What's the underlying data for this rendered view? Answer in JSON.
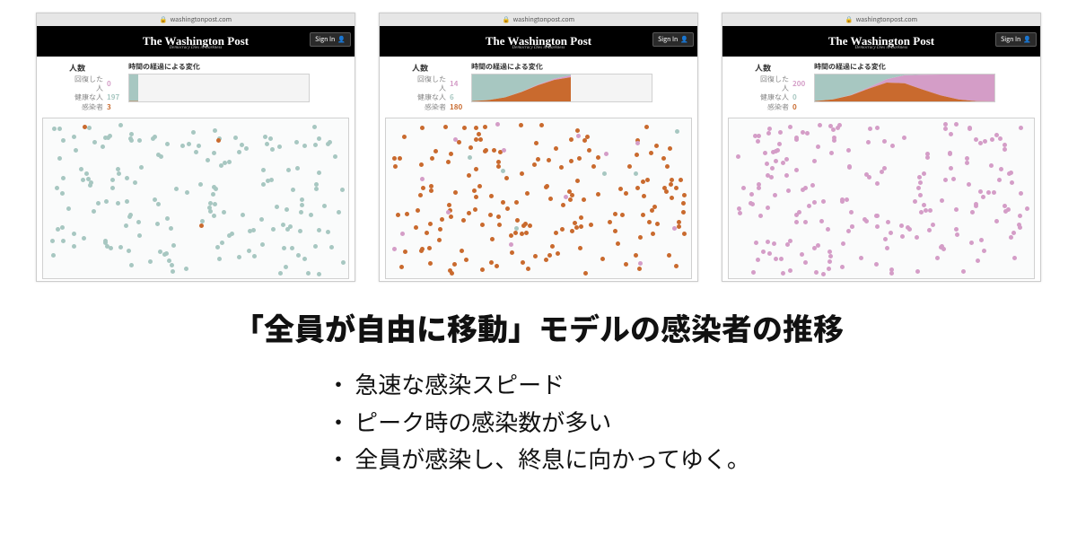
{
  "url_bar": {
    "domain": "washingtonpost.com"
  },
  "header": {
    "logo": "The Washington Post",
    "tagline": "Democracy Dies in Darkness",
    "sign_in": "Sign In"
  },
  "legend": {
    "count_title": "人数",
    "chart_title": "時間の経過による変化",
    "recovered_label": "回復した人",
    "healthy_label": "健康な人",
    "infected_label": "感染者"
  },
  "colors": {
    "healthy": "#a7c7c1",
    "infected": "#c96a2e",
    "recovered": "#d49dc7"
  },
  "panels": [
    {
      "recovered": 0,
      "healthy": 197,
      "infected": 3,
      "progress": 0.05,
      "dots": {
        "healthy": 170,
        "infected": 3,
        "recovered": 0
      }
    },
    {
      "recovered": 14,
      "healthy": 6,
      "infected": 180,
      "progress": 0.55,
      "dots": {
        "healthy": 6,
        "infected": 175,
        "recovered": 14
      }
    },
    {
      "recovered": 200,
      "healthy": 0,
      "infected": 0,
      "progress": 1.0,
      "dots": {
        "healthy": 0,
        "infected": 0,
        "recovered": 200
      }
    }
  ],
  "chart_data": [
    {
      "type": "area",
      "title": "時間の経過による変化",
      "xlabel": "",
      "ylabel": "",
      "x_progress": 0.05,
      "total": 200,
      "series": [
        {
          "name": "回復した人",
          "color": "#d49dc7",
          "values": [
            0,
            0
          ]
        },
        {
          "name": "感染者",
          "color": "#c96a2e",
          "values": [
            3,
            3
          ]
        },
        {
          "name": "健康な人",
          "color": "#a7c7c1",
          "values": [
            197,
            197
          ]
        }
      ]
    },
    {
      "type": "area",
      "title": "時間の経過による変化",
      "xlabel": "",
      "ylabel": "",
      "x_progress": 0.55,
      "total": 200,
      "series": [
        {
          "name": "回復した人",
          "color": "#d49dc7",
          "values": [
            0,
            0,
            0,
            2,
            5,
            9,
            14
          ]
        },
        {
          "name": "感染者",
          "color": "#c96a2e",
          "values": [
            3,
            10,
            30,
            70,
            120,
            160,
            180
          ]
        },
        {
          "name": "健康な人",
          "color": "#a7c7c1",
          "values": [
            197,
            190,
            170,
            128,
            75,
            31,
            6
          ]
        }
      ]
    },
    {
      "type": "area",
      "title": "時間の経過による変化",
      "xlabel": "",
      "ylabel": "",
      "x_progress": 1.0,
      "total": 200,
      "series": [
        {
          "name": "回復した人",
          "color": "#d49dc7",
          "values": [
            0,
            0,
            2,
            8,
            25,
            60,
            110,
            155,
            185,
            198,
            200
          ]
        },
        {
          "name": "感染者",
          "color": "#c96a2e",
          "values": [
            3,
            15,
            45,
            95,
            140,
            135,
            88,
            45,
            15,
            2,
            0
          ]
        },
        {
          "name": "健康な人",
          "color": "#a7c7c1",
          "values": [
            197,
            185,
            153,
            97,
            35,
            5,
            2,
            0,
            0,
            0,
            0
          ]
        }
      ]
    }
  ],
  "caption": {
    "title_bold": "「全員が自由に移動」",
    "title_rest": "モデルの感染者の推移",
    "bullets": [
      "急速な感染スピード",
      "ピーク時の感染数が多い",
      "全員が感染し、終息に向かってゆく。"
    ]
  }
}
